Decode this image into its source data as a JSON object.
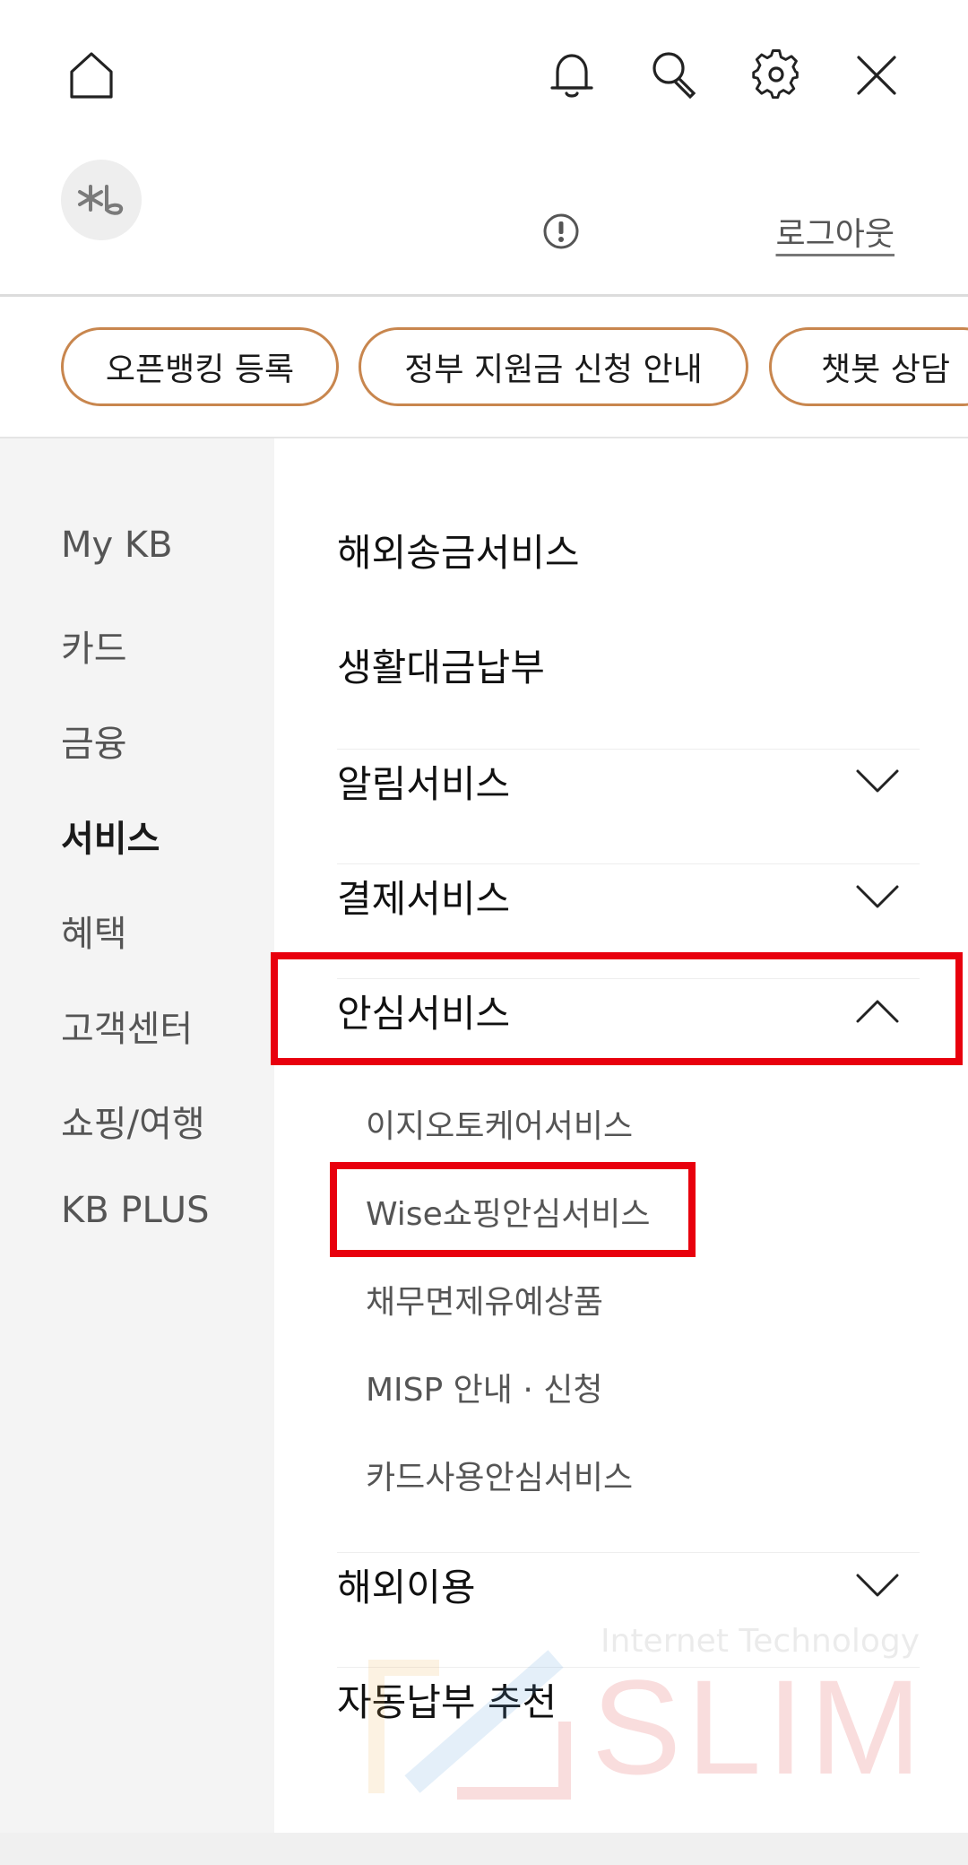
{
  "header": {
    "icons": [
      "home-icon",
      "bell-icon",
      "search-icon",
      "gear-icon",
      "close-icon"
    ]
  },
  "profile": {
    "avatar_icon": "kb-star-icon",
    "info_icon": "exclamation-icon",
    "logout_label": "로그아웃"
  },
  "quick_links": [
    {
      "label": "오픈뱅킹 등록"
    },
    {
      "label": "정부 지원금 신청 안내"
    },
    {
      "label": "챗봇 상담"
    }
  ],
  "sidebar": {
    "items": [
      {
        "label": "My KB",
        "active": false
      },
      {
        "label": "카드",
        "active": false
      },
      {
        "label": "금융",
        "active": false
      },
      {
        "label": "서비스",
        "active": true
      },
      {
        "label": "혜택",
        "active": false
      },
      {
        "label": "고객센터",
        "active": false
      },
      {
        "label": "쇼핑/여행",
        "active": false
      },
      {
        "label": "KB PLUS",
        "active": false
      }
    ]
  },
  "menu": {
    "items": [
      {
        "label": "해외송금서비스"
      },
      {
        "label": "생활대금납부"
      },
      {
        "label": "알림서비스",
        "expandable": true
      },
      {
        "label": "결제서비스",
        "expandable": true
      },
      {
        "label": "안심서비스",
        "expandable": true,
        "expanded": true
      },
      {
        "label": "해외이용",
        "expandable": true
      },
      {
        "label": "자동납부 추천"
      }
    ],
    "sub_items": [
      {
        "label": "이지오토케어서비스"
      },
      {
        "label": "Wise쇼핑안심서비스"
      },
      {
        "label": "채무면제유예상품"
      },
      {
        "label": "MISP 안내 · 신청"
      },
      {
        "label": "카드사용안심서비스"
      }
    ]
  },
  "watermark": {
    "small": "Internet Technology",
    "big": "SLIM"
  },
  "colors": {
    "chip_border": "#c8864e",
    "highlight": "#e8000d",
    "sidebar_bg": "#f4f4f4"
  }
}
